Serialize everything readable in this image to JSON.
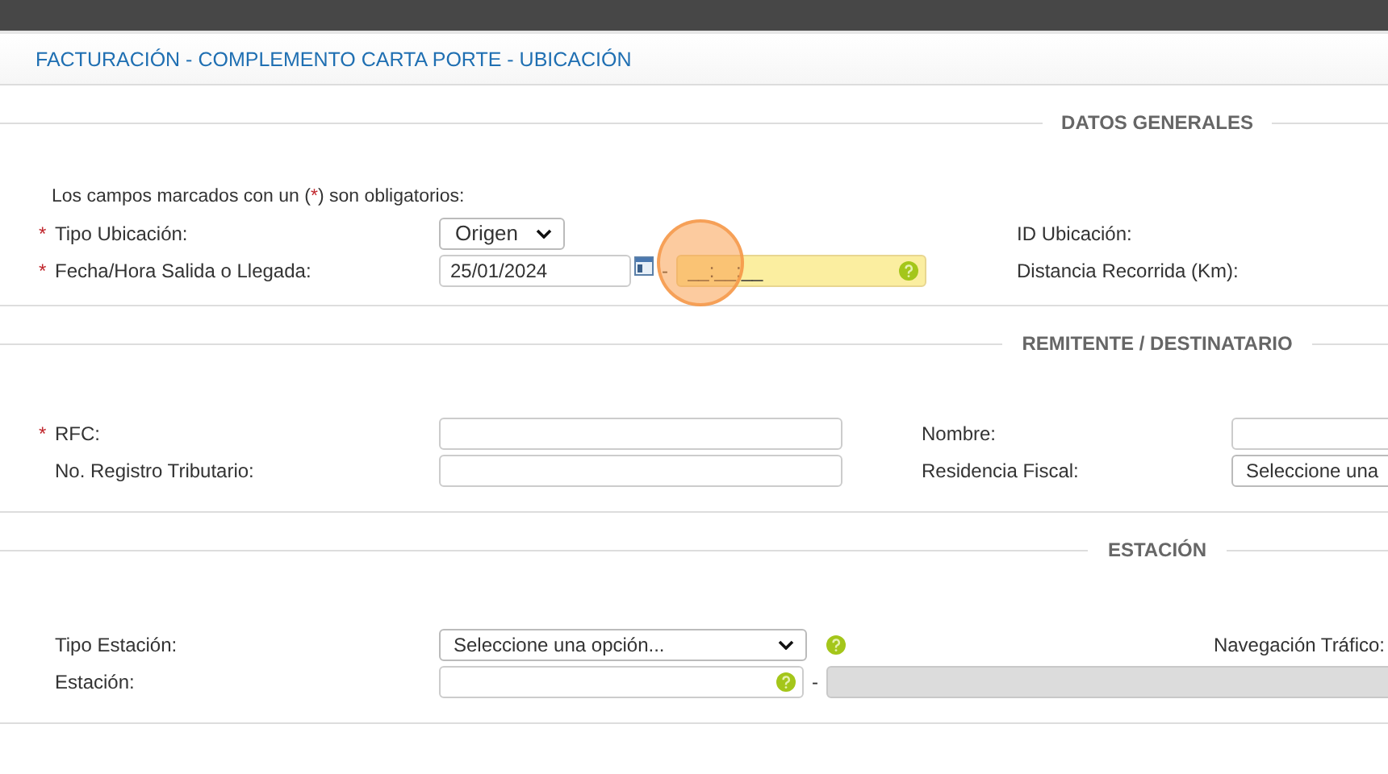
{
  "title": "FACTURACIÓN - COMPLEMENTO CARTA PORTE - UBICACIÓN",
  "datos_generales": {
    "title": "DATOS GENERALES",
    "note": {
      "before": "Los campos marcados con un (",
      "mark": "*",
      "after": ") son obligatorios:"
    },
    "tipo_ubicacion": {
      "label": "Tipo Ubicación:",
      "required": true,
      "value": "Origen"
    },
    "fecha_hora": {
      "label": "Fecha/Hora Salida o Llegada:",
      "required": true,
      "date": "25/01/2024",
      "separator": "-",
      "time": "__:__:__",
      "focused": true
    },
    "id_ubicacion": {
      "label": "ID Ubicación:"
    },
    "distancia": {
      "label": "Distancia Recorrida (Km):"
    }
  },
  "remitente": {
    "title": "REMITENTE / DESTINATARIO",
    "rfc": {
      "label": "RFC:",
      "required": true
    },
    "registro": {
      "label": "No. Registro Tributario:",
      "required": false
    },
    "nombre": {
      "label": "Nombre:"
    },
    "residencia": {
      "label": "Residencia Fiscal:",
      "value": "Seleccione una"
    }
  },
  "estacion": {
    "title": "ESTACIÓN",
    "tipo": {
      "label": "Tipo Estación:",
      "required": false,
      "value": "Seleccione una opción..."
    },
    "estacion": {
      "label": "Estación:",
      "required": false,
      "separator": "-"
    },
    "navegacion": {
      "label": "Navegación Tráfico:"
    }
  }
}
